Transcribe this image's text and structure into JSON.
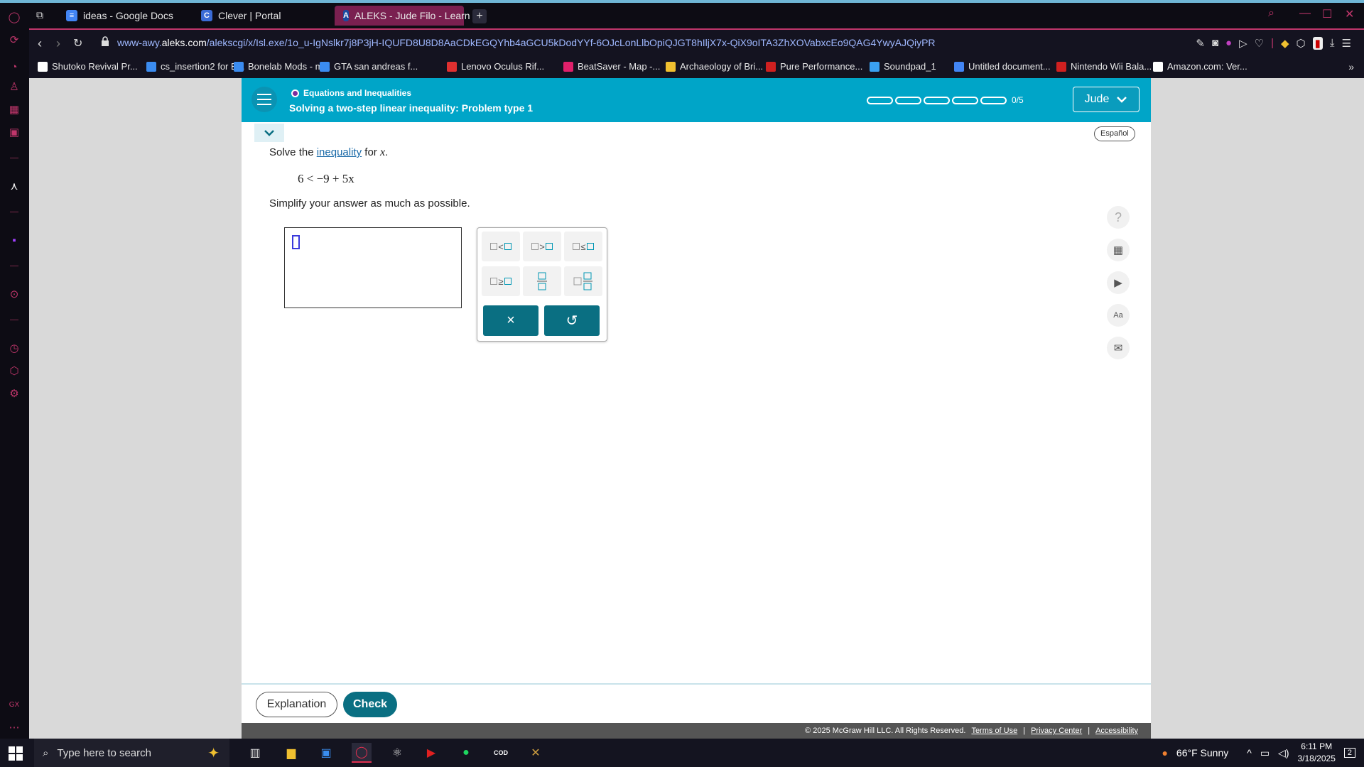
{
  "browser": {
    "tabs": [
      {
        "label": "ideas - Google Docs",
        "color": "#4285f4",
        "glyph": "≡"
      },
      {
        "label": "Clever | Portal",
        "color": "#3a6bd6",
        "glyph": "C"
      },
      {
        "label": "ALEKS - Jude Filo - Learn",
        "color": "#1b4aa0",
        "glyph": "A"
      }
    ],
    "url_prefix": "www-awy.",
    "url_domain": "aleks.com",
    "url_path": "/alekscgi/x/Isl.exe/1o_u-IgNslkr7j8P3jH-IQUFD8U8D8AaCDkEGQYhb4aGCU5kDodYYf-6OJcLonLlbOpiQJGT8hIljX7x-QiX9oITA3ZhXOVabxcEo9QAG4YwyAJQiyPR",
    "bookmarks": [
      {
        "label": "Shutoko Revival Pr...",
        "color": "#ffffff"
      },
      {
        "label": "cs_insertion2 for B...",
        "color": "#3b8cf0"
      },
      {
        "label": "Bonelab Mods - m...",
        "color": "#3b8cf0"
      },
      {
        "label": "GTA san andreas f...",
        "color": "#3b8cf0"
      },
      {
        "label": "Lenovo Oculus Rif...",
        "color": "#e03030"
      },
      {
        "label": "BeatSaver - Map -...",
        "color": "#e0206a"
      },
      {
        "label": "Archaeology of Bri...",
        "color": "#f0c030"
      },
      {
        "label": "Pure Performance...",
        "color": "#d02020"
      },
      {
        "label": "Soundpad_1",
        "color": "#3aa0f0"
      },
      {
        "label": "Untitled document...",
        "color": "#4285f4"
      },
      {
        "label": "Nintendo Wii Bala...",
        "color": "#d02020"
      },
      {
        "label": "Amazon.com: Ver...",
        "color": "#ffffff"
      }
    ]
  },
  "aleks": {
    "topic": "Equations and Inequalities",
    "lesson": "Solving a two-step linear inequality: Problem type 1",
    "progress_text": "0/5",
    "progress_filled": 0,
    "progress_total": 5,
    "user": "Jude",
    "espanol": "Español",
    "question_prefix": "Solve the",
    "question_link": "inequality",
    "question_suffix": "for",
    "question_var": "x",
    "question_period": ".",
    "equation": "6 < −9 + 5x",
    "instruction": "Simplify your answer as much as possible.",
    "keypad": {
      "lt": "<",
      "gt": ">",
      "le": "≤",
      "ge": "≥",
      "clear": "×",
      "undo": "↺"
    },
    "explanation_label": "Explanation",
    "check_label": "Check",
    "footer": {
      "copyright": "© 2025 McGraw Hill LLC. All Rights Reserved.",
      "terms": "Terms of Use",
      "privacy": "Privacy Center",
      "accessibility": "Accessibility",
      "sep": "|"
    },
    "accent": "#00a5c8",
    "button_color": "#0a6f82"
  },
  "taskbar": {
    "search_placeholder": "Type here to search",
    "weather": "66°F  Sunny",
    "time": "6:11 PM",
    "date": "3/18/2025",
    "notif_count": "2"
  }
}
